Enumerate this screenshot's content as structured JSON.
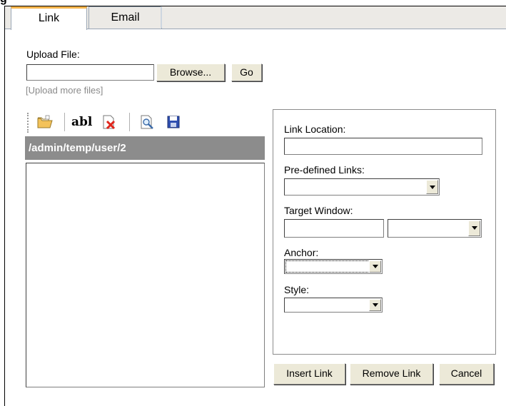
{
  "tabs": [
    {
      "label": "Link",
      "active": true
    },
    {
      "label": "Email",
      "active": false
    }
  ],
  "upload": {
    "label": "Upload File:",
    "file_value": "",
    "browse_label": "Browse...",
    "go_label": "Go",
    "more_link": "[Upload more files]"
  },
  "file_browser": {
    "toolbar_icons": [
      "open-folder-icon",
      "rename-icon",
      "delete-icon",
      "preview-icon",
      "save-icon"
    ],
    "rename_glyph": "abl",
    "current_path": "/admin/temp/user/2",
    "files": []
  },
  "properties": {
    "link_location_label": "Link Location:",
    "link_location_value": "",
    "predefined_links_label": "Pre-defined Links:",
    "predefined_links_value": "",
    "target_window_label": "Target Window:",
    "target_window_value": "",
    "target_window_select_value": "",
    "anchor_label": "Anchor:",
    "anchor_value": "",
    "style_label": "Style:",
    "style_value": ""
  },
  "actions": {
    "insert_label": "Insert Link",
    "remove_label": "Remove Link",
    "cancel_label": "Cancel"
  },
  "colors": {
    "active_tab_accent": "#f3b34a",
    "path_bar_bg": "#8c8c8c",
    "button_face": "#ece9d8"
  }
}
